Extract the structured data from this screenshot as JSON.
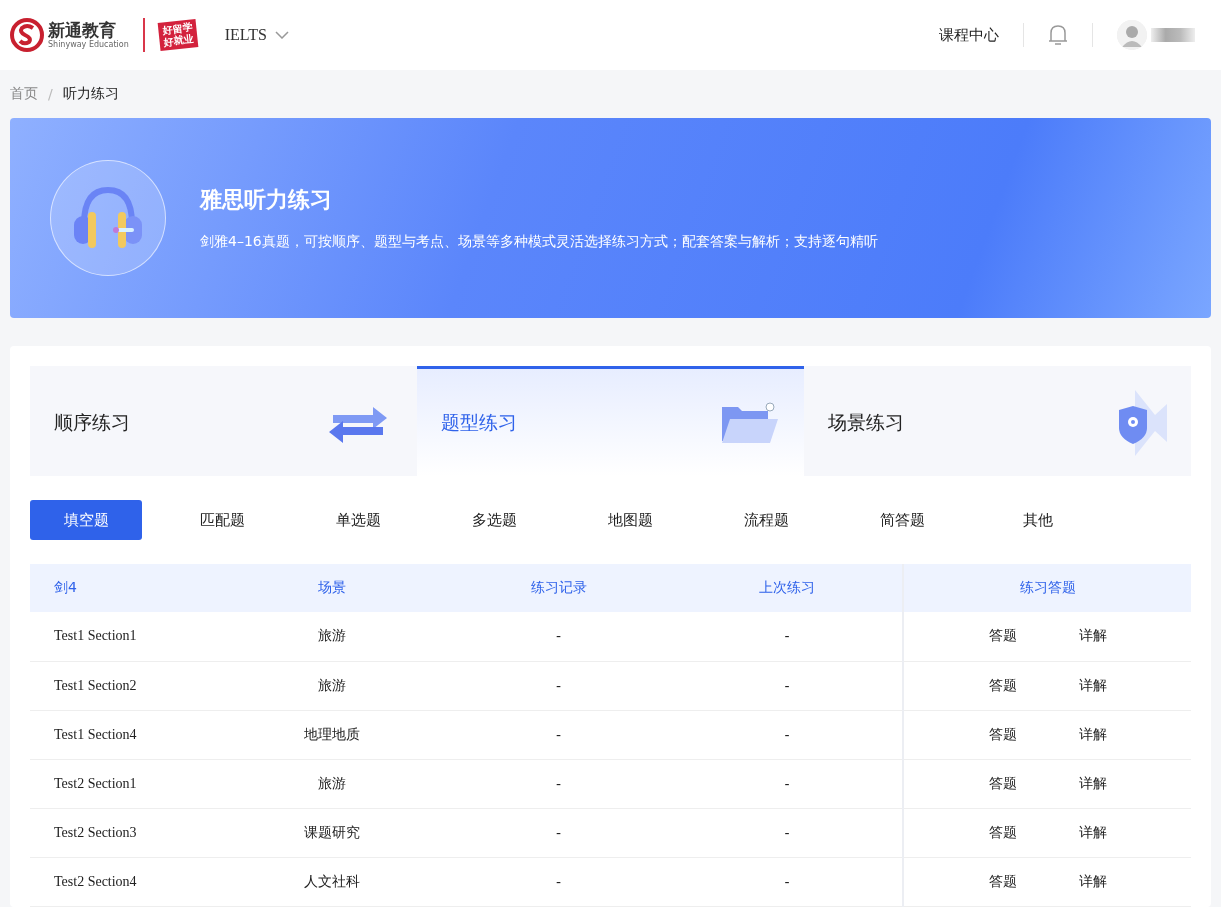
{
  "header": {
    "logo_name": "新通教育",
    "logo_sub": "Shinyway Education",
    "slogan_lines": [
      "好留学",
      "好就业"
    ],
    "exam_select": "IELTS",
    "nav_link": "课程中心"
  },
  "breadcrumb_separator": "/",
  "breadcrumb": [
    {
      "label": "首页",
      "current": false
    },
    {
      "label": "听力练习",
      "current": true
    }
  ],
  "banner": {
    "title": "雅思听力练习",
    "description": "剑雅4–16真题，可按顺序、题型与考点、场景等多种模式灵活选择练习方式；配套答案与解析；支持逐句精听"
  },
  "modes": [
    {
      "label": "顺序练习",
      "kind": "arrows",
      "selected": false
    },
    {
      "label": "题型练习",
      "kind": "folder",
      "selected": true
    },
    {
      "label": "场景练习",
      "kind": "location",
      "selected": false
    }
  ],
  "question_types": [
    {
      "label": "填空题",
      "selected": true
    },
    {
      "label": "匹配题",
      "selected": false
    },
    {
      "label": "单选题",
      "selected": false
    },
    {
      "label": "多选题",
      "selected": false
    },
    {
      "label": "地图题",
      "selected": false
    },
    {
      "label": "流程题",
      "selected": false
    },
    {
      "label": "简答题",
      "selected": false
    },
    {
      "label": "其他",
      "selected": false
    }
  ],
  "table": {
    "columns": [
      "剑4",
      "场景",
      "练习记录",
      "上次练习",
      "练习答题"
    ],
    "rows": [
      {
        "test": "Test1 Section1",
        "scene": "旅游",
        "record": "-",
        "last": "-",
        "actions": [
          "答题",
          "详解"
        ]
      },
      {
        "test": "Test1 Section2",
        "scene": "旅游",
        "record": "-",
        "last": "-",
        "actions": [
          "答题",
          "详解"
        ]
      },
      {
        "test": "Test1 Section4",
        "scene": "地理地质",
        "record": "-",
        "last": "-",
        "actions": [
          "答题",
          "详解"
        ]
      },
      {
        "test": "Test2 Section1",
        "scene": "旅游",
        "record": "-",
        "last": "-",
        "actions": [
          "答题",
          "详解"
        ]
      },
      {
        "test": "Test2 Section3",
        "scene": "课题研究",
        "record": "-",
        "last": "-",
        "actions": [
          "答题",
          "详解"
        ]
      },
      {
        "test": "Test2 Section4",
        "scene": "人文社科",
        "record": "-",
        "last": "-",
        "actions": [
          "答题",
          "详解"
        ]
      }
    ]
  }
}
